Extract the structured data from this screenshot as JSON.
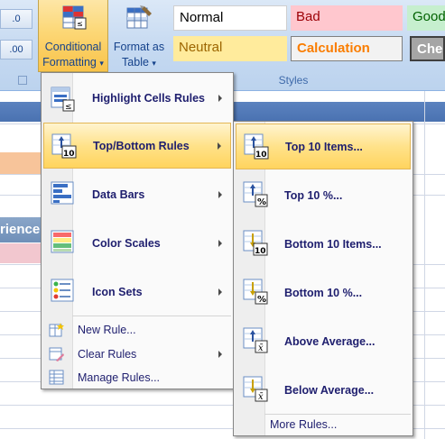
{
  "ribbon": {
    "edge_buttons": [
      ".0",
      ".00"
    ],
    "conditional_formatting": {
      "line1": "Conditional",
      "line2": "Formatting",
      "arrow": "▾"
    },
    "format_as_table": {
      "line1": "Format as",
      "line2": "Table",
      "arrow": "▾"
    },
    "styles": {
      "normal": "Normal",
      "bad": "Bad",
      "good": "Good",
      "neutral": "Neutral",
      "calculation": "Calculation",
      "check": "Check"
    },
    "group_label": "Styles"
  },
  "sheet": {
    "partial_header": "rience"
  },
  "menu": {
    "items": [
      {
        "label": "Highlight Cells Rules",
        "icon": "highlight-cells-icon"
      },
      {
        "label": "Top/Bottom Rules",
        "icon": "top-bottom-icon"
      },
      {
        "label": "Data Bars",
        "icon": "data-bars-icon"
      },
      {
        "label": "Color Scales",
        "icon": "color-scales-icon"
      },
      {
        "label": "Icon Sets",
        "icon": "icon-sets-icon"
      }
    ],
    "commands": [
      {
        "label": "New Rule...",
        "icon": "new-rule-icon"
      },
      {
        "label": "Clear Rules",
        "icon": "clear-rules-icon"
      },
      {
        "label": "Manage Rules...",
        "icon": "manage-rules-icon"
      }
    ]
  },
  "submenu": {
    "items": [
      {
        "label": "Top 10 Items...",
        "icon": "top-10-items-icon"
      },
      {
        "label": "Top 10 %...",
        "icon": "top-10-percent-icon"
      },
      {
        "label": "Bottom 10 Items...",
        "icon": "bottom-10-items-icon"
      },
      {
        "label": "Bottom 10 %...",
        "icon": "bottom-10-percent-icon"
      },
      {
        "label": "Above Average...",
        "icon": "above-average-icon"
      },
      {
        "label": "Below Average...",
        "icon": "below-average-icon"
      }
    ],
    "more": "More Rules..."
  },
  "colors": {
    "highlight": "#ffd45e",
    "ribbon": "#c5d9f1",
    "menu_text": "#1e1e6e"
  }
}
